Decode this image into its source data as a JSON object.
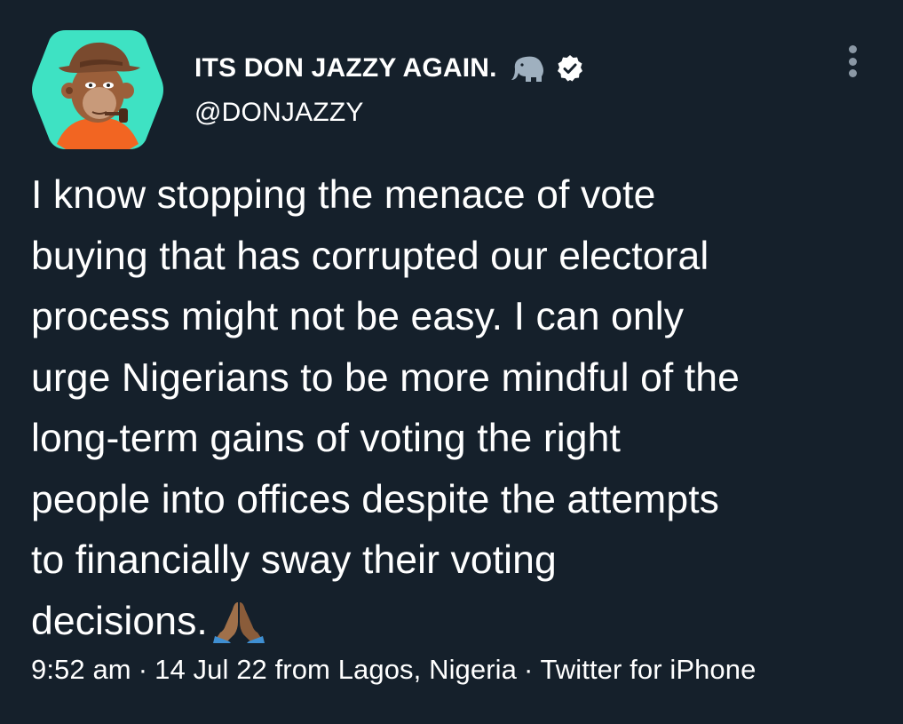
{
  "author": {
    "display_name": "ITS DON JAZZY AGAIN.",
    "handle": "@DONJAZZY",
    "avatar_icon": "bored-ape-avatar",
    "name_badges": [
      "mastodon-elephant-icon",
      "verified-badge-icon"
    ]
  },
  "tweet": {
    "lines": [
      "I know stopping the menace of vote",
      "buying that has corrupted our electoral",
      "process might not be easy. I can only",
      "urge Nigerians to be more mindful of the",
      "long-term gains of voting the right",
      "people into offices despite the attempts",
      "to financially sway their voting",
      "decisions."
    ],
    "emoji": "folded-hands-icon"
  },
  "meta": {
    "time": "9:52 am",
    "separator": "·",
    "date_location": "14 Jul 22 from Lagos, Nigeria",
    "client": "Twitter for iPhone"
  },
  "colors": {
    "background": "#15202b",
    "text": "#ffffff",
    "muted": "#8b98a5",
    "avatar_bg": "#3ee2c3",
    "verified": "#ffffff"
  }
}
